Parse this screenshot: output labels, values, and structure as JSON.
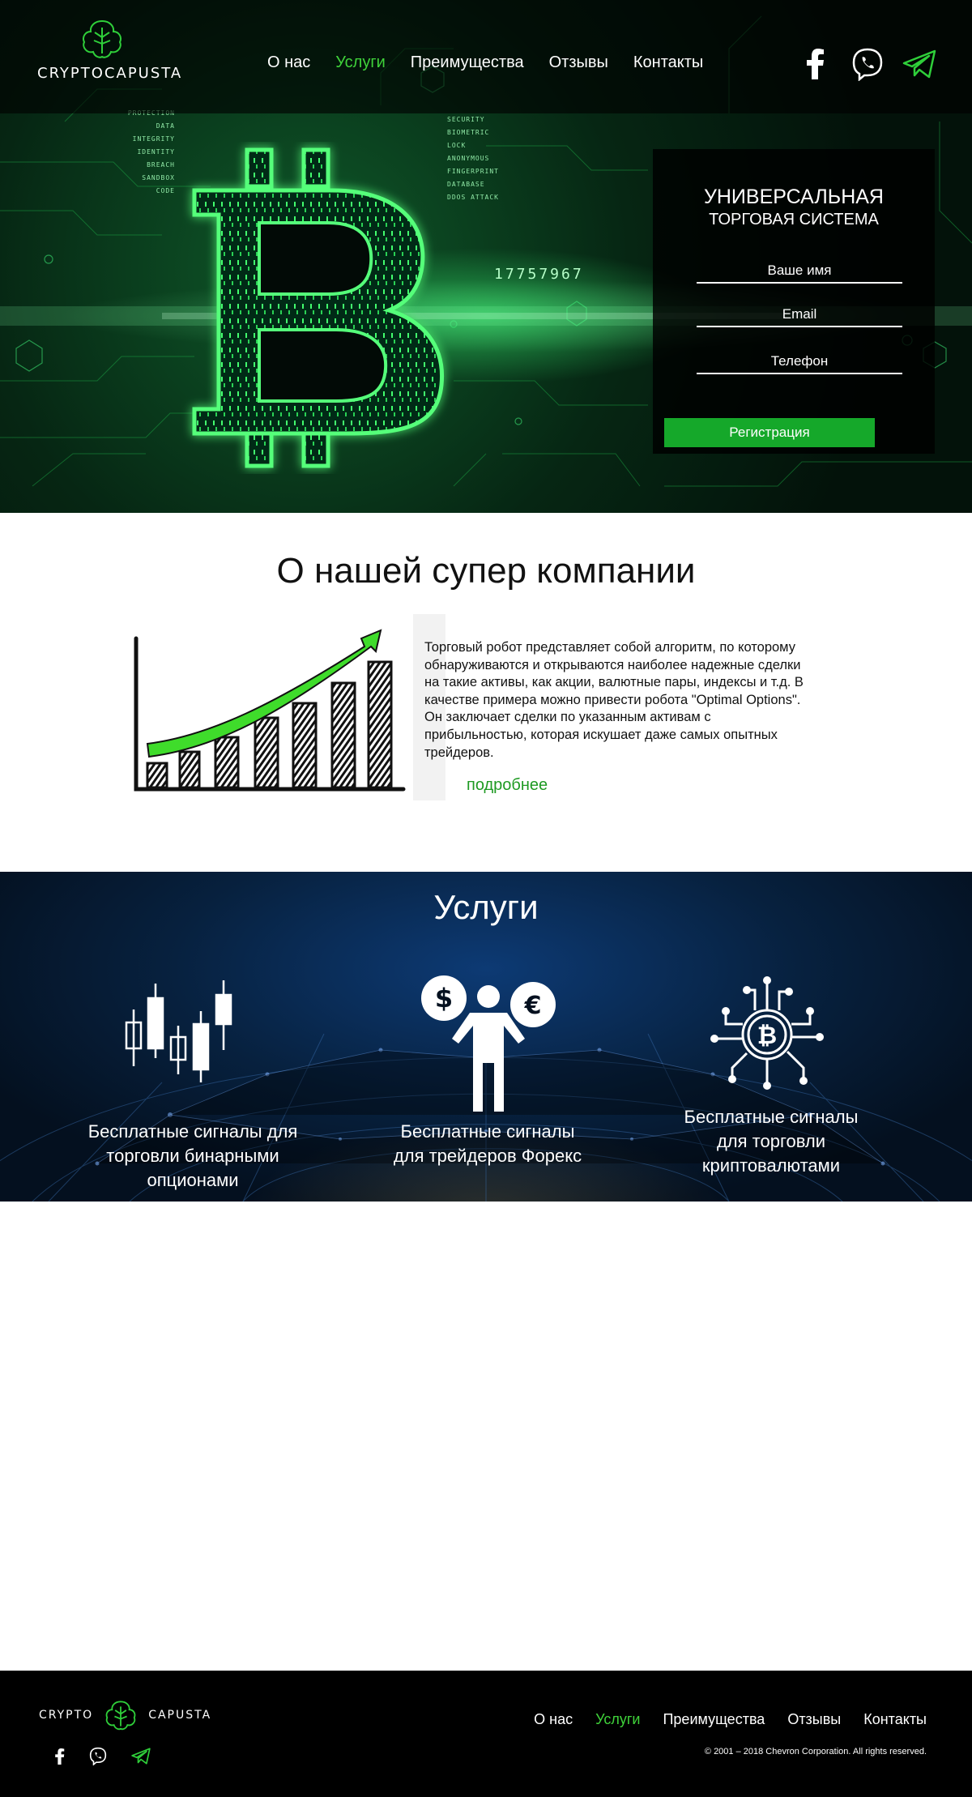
{
  "header": {
    "logo_text": "CRYPTOCAPUSTA",
    "nav": [
      {
        "label": "О нас",
        "active": false
      },
      {
        "label": "Услуги",
        "active": true
      },
      {
        "label": "Преимущества",
        "active": false
      },
      {
        "label": "Отзывы",
        "active": false
      },
      {
        "label": "Контакты",
        "active": false
      }
    ],
    "socials": [
      "facebook-icon",
      "viber-icon",
      "telegram-icon"
    ]
  },
  "hero": {
    "tags_left": [
      "PROTECTION",
      "DATA INTEGRITY",
      "IDENTITY",
      "BREACH",
      "SANDBOX",
      "CODE"
    ],
    "tags_right": [
      "SECURITY",
      "BIOMETRIC",
      "LOCK",
      "ANONYMOUS",
      "FINGERPRINT",
      "DATABASE",
      "DDOS ATTACK"
    ],
    "number_text": "17757967",
    "form": {
      "title_line1": "УНИВЕРСАЛЬНАЯ",
      "title_line2": "ТОРГОВАЯ СИСТЕМА",
      "name_placeholder": "Ваше имя",
      "email_placeholder": "Email",
      "phone_placeholder": "Телефон",
      "submit_label": "Регистрация"
    }
  },
  "about": {
    "title": "О нашей супер компании",
    "text": "Торговый робот представляет собой алгоритм, по которому обнаруживаются и открываются наиболее надежные сделки на такие активы, как акции, валютные пары, индексы и т.д. В качестве примера можно привести робота \"Optimal Options\". Он заключает сделки по указанным активам с прибыльностью, которая искушает даже самых опытных трейдеров.",
    "more_label": "подробнее"
  },
  "services": {
    "title": "Услуги",
    "items": [
      {
        "icon": "candlestick-chart-icon",
        "line1": "Бесплатные сигналы для",
        "line2": "торговли бинарными",
        "line3": "опционами"
      },
      {
        "icon": "forex-trader-icon",
        "line1": "Бесплатные сигналы",
        "line2": "для трейдеров Форекс",
        "line3": ""
      },
      {
        "icon": "bitcoin-circuit-icon",
        "line1": "Бесплатные сигналы",
        "line2": "для торговли",
        "line3": "криптовалютами"
      }
    ]
  },
  "footer": {
    "logo_left": "CRYPTO",
    "logo_right": "CAPUSTA",
    "nav": [
      {
        "label": "О нас",
        "active": false
      },
      {
        "label": "Услуги",
        "active": true
      },
      {
        "label": "Преимущества",
        "active": false
      },
      {
        "label": "Отзывы",
        "active": false
      },
      {
        "label": "Контакты",
        "active": false
      }
    ],
    "copyright": "© 2001 – 2018 Chevron Corporation. All rights reserved."
  },
  "colors": {
    "accent_green": "#3fd23a",
    "button_green": "#15a82a",
    "link_green": "#1e9a22",
    "footer_bg": "#000000"
  }
}
